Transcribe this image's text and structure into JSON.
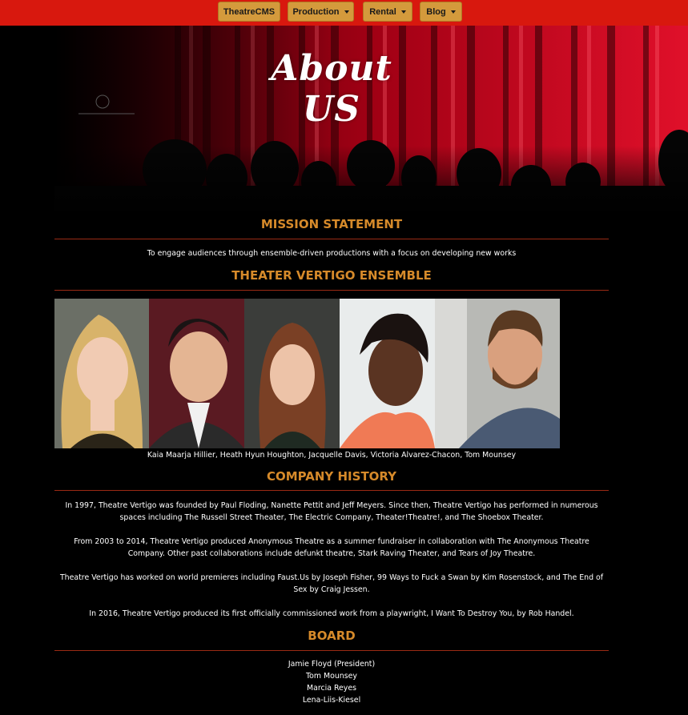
{
  "nav": {
    "brand": "TheatreCMS",
    "production": "Production",
    "rental": "Rental",
    "blog": "Blog"
  },
  "hero": {
    "title": "About US"
  },
  "mission": {
    "title": "MISSION STATEMENT",
    "text": "To engage audiences through ensemble-driven productions with a focus on developing new works"
  },
  "ensemble": {
    "title": "THEATER VERTIGO ENSEMBLE",
    "caption": "Kaia Maarja Hillier, Heath Hyun Houghton, Jacquelle Davis, Victoria Alvarez-Chacon, Tom Mounsey"
  },
  "history": {
    "title": "COMPANY HISTORY",
    "paragraphs": [
      "In 1997, Theatre Vertigo was founded by Paul Floding, Nanette Pettit and Jeff Meyers. Since then, Theatre Vertigo has performed in numerous spaces including The Russell Street Theater, The Electric Company, Theater!Theatre!, and The Shoebox Theater.",
      "From 2003 to 2014, Theatre Vertigo produced Anonymous Theatre as a summer fundraiser in collaboration with The Anonymous Theatre Company. Other past collaborations include defunkt theatre, Stark Raving Theater, and Tears of Joy Theatre.",
      "Theatre Vertigo has worked on world premieres including Faust.Us by Joseph Fisher, 99 Ways to Fuck a Swan by Kim Rosenstock, and The End of Sex by Craig Jessen.",
      "In 2016, Theatre Vertigo produced its first officially commissioned work from a playwright, I Want To Destroy You, by Rob Handel."
    ]
  },
  "board": {
    "title": "BOARD",
    "members": [
      "Jamie Floyd (President)",
      "Tom Mounsey",
      "Marcia Reyes",
      "Lena-Liis-Kiesel"
    ]
  },
  "colors": {
    "navbar": "#d8180e",
    "nav_button": "#d49a3c",
    "section_title": "#d68a2a",
    "rule": "#9b2a14",
    "background": "#000000"
  }
}
